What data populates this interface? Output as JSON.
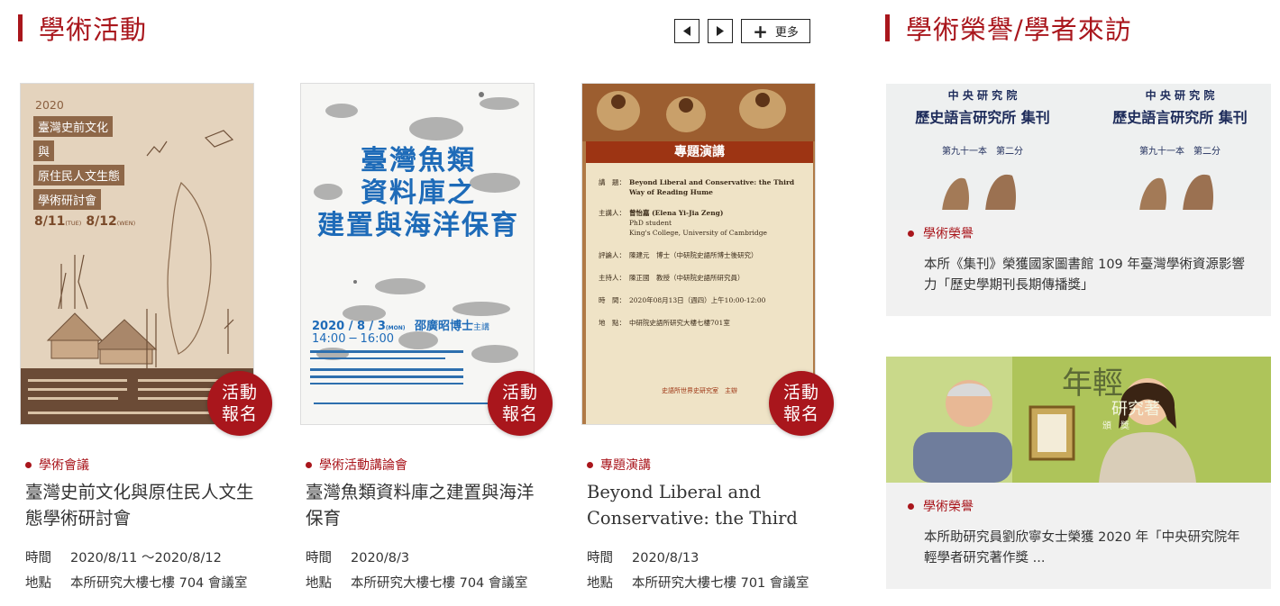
{
  "left_section": {
    "title": "學術活動",
    "more_label": "更多",
    "prev_icon": "triangle-left-icon",
    "next_icon": "triangle-right-icon"
  },
  "right_section": {
    "title": "學術榮譽/學者來訪"
  },
  "events": [
    {
      "badge_line1": "活動",
      "badge_line2": "報名",
      "category": "學術會議",
      "title": "臺灣史前文化與原住民人文生態學術研討會",
      "time_label": "時間",
      "time": "2020/8/11 ～2020/8/12",
      "place_label": "地點",
      "place": "本所研究大樓七樓 704 會議室",
      "poster": {
        "year": "2020",
        "line1": "臺灣史前文化",
        "line2": "與",
        "line3": "原住民人文生態",
        "line4": "學術研討會",
        "date1": "8/11",
        "dow1": "(TUE)",
        "date2": "8/12",
        "dow2": "(WEN)"
      }
    },
    {
      "badge_line1": "活動",
      "badge_line2": "報名",
      "category": "學術活動講論會",
      "title": "臺灣魚類資料庫之建置與海洋保育",
      "time_label": "時間",
      "time": "2020/8/3",
      "place_label": "地點",
      "place": "本所研究大樓七樓 704 會議室",
      "poster": {
        "line1": "臺灣魚類",
        "line2": "資料庫之",
        "line3": "建置與海洋保育",
        "date": "2020 / 8 / 3",
        "dow": "(MON)",
        "hours": "14:00 ─ 16:00",
        "speaker": "邵廣昭博士",
        "speaker_role": "主講"
      }
    },
    {
      "badge_line1": "活動",
      "badge_line2": "報名",
      "category": "專題演講",
      "title": "Beyond Liberal and Conservative: the Third Way of Reading Hume",
      "time_label": "時間",
      "time": "2020/8/13",
      "place_label": "地點",
      "place": "本所研究大樓七樓 701 會議室",
      "poster": {
        "banner": "專題演講",
        "topic_label": "講　題：",
        "topic": "Beyond Liberal and Conservative: the Third Way of Reading Hume",
        "speaker_label": "主講人：",
        "speaker": "曾怡嘉 (Elena Yi-Jia Zeng)",
        "speaker_detail1": "PhD student",
        "speaker_detail2": "King's College, University of Cambridge",
        "discussant_label": "評論人：",
        "discussant": "陳建元　博士（中研院史語所博士後研究）",
        "host_label": "主持人：",
        "host": "陳正國　教授（中研院史語所研究員）",
        "time_label": "時　間：",
        "time": "2020年08月13日（週四）上午10:00-12:00",
        "place_label": "地　點：",
        "place": "中研院史語所研究大樓七樓701室",
        "organizer": "史語所世界史研究室　主辦"
      }
    }
  ],
  "honors": [
    {
      "category": "學術榮譽",
      "text": "本所《集刊》榮獲國家圖書館 109 年臺灣學術資源影響力「歷史學期刊長期傳播獎」",
      "image": {
        "institute": "中 央 研 究 院",
        "journal": "歷史語言研究所 集刊",
        "issue": "第九十一本　第二分"
      }
    },
    {
      "category": "學術榮譽",
      "text": "本所助研究員劉欣寧女士榮獲 2020 年「中央研究院年輕學者研究著作獎 ...",
      "image": {
        "backdrop_text": "年輕",
        "backdrop_sub": "研究著",
        "award_mark": "頒　獎"
      }
    }
  ]
}
